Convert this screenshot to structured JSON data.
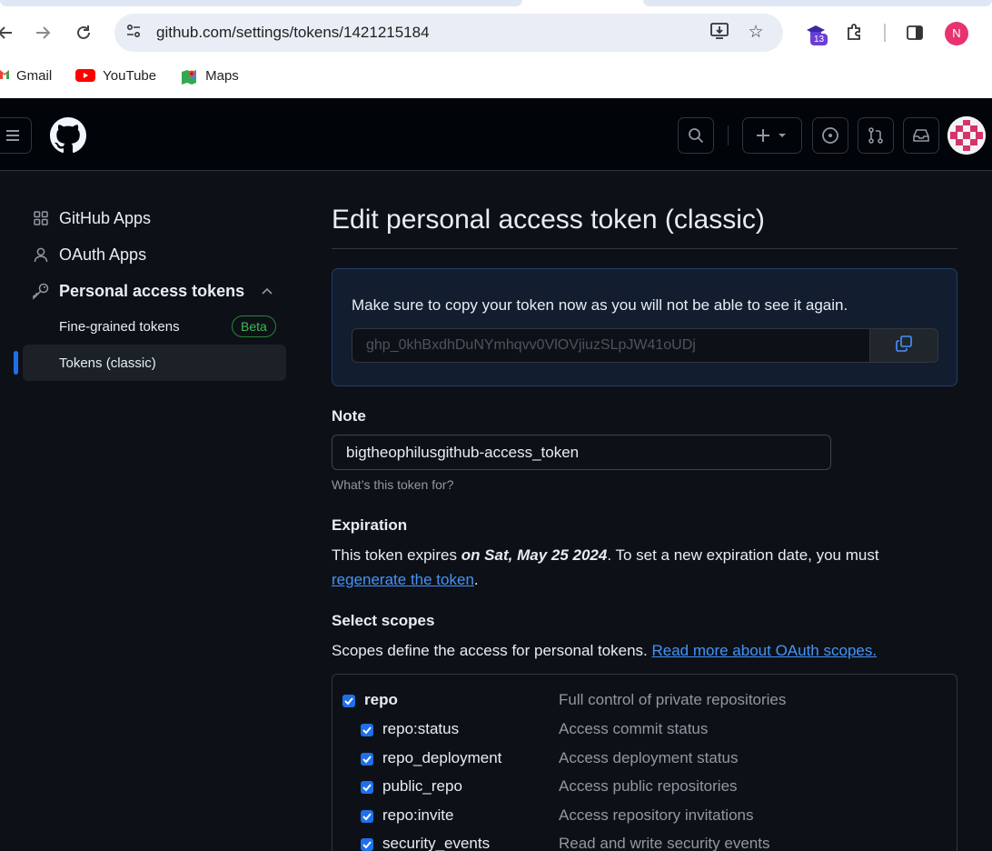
{
  "browser": {
    "url": "github.com/settings/tokens/1421215184",
    "extension_badge": "13",
    "profile_initial": "N",
    "bookmarks": [
      {
        "label": "Gmail",
        "icon": "gmail-icon"
      },
      {
        "label": "YouTube",
        "icon": "youtube-icon"
      },
      {
        "label": "Maps",
        "icon": "maps-icon"
      }
    ]
  },
  "sidebar": {
    "items": [
      {
        "label": "GitHub Apps",
        "icon": "apps-grid-icon"
      },
      {
        "label": "OAuth Apps",
        "icon": "person-icon"
      },
      {
        "label": "Personal access tokens",
        "icon": "key-icon"
      }
    ],
    "sub_items": [
      {
        "label": "Fine-grained tokens",
        "badge": "Beta"
      },
      {
        "label": "Tokens (classic)"
      }
    ]
  },
  "main": {
    "title": "Edit personal access token (classic)",
    "flash_message": "Make sure to copy your token now as you will not be able to see it again.",
    "token_value": "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",
    "note_label": "Note",
    "note_value": "bigtheophilusgithub-access_token",
    "note_hint": "What’s this token for?",
    "expiration_label": "Expiration",
    "expiration_prefix": "This token expires ",
    "expiration_date": "on Sat, May 25 2024",
    "expiration_suffix": ". To set a new expiration date, you must",
    "regenerate_link": "regenerate the token",
    "regenerate_after": ".",
    "scopes_label": "Select scopes",
    "scopes_intro": "Scopes define the access for personal tokens. ",
    "scopes_link": "Read more about OAuth scopes.",
    "scopes": [
      {
        "name": "repo",
        "desc": "Full control of private repositories",
        "checked": true,
        "child": false
      },
      {
        "name": "repo:status",
        "desc": "Access commit status",
        "checked": true,
        "child": true
      },
      {
        "name": "repo_deployment",
        "desc": "Access deployment status",
        "checked": true,
        "child": true
      },
      {
        "name": "public_repo",
        "desc": "Access public repositories",
        "checked": true,
        "child": true
      },
      {
        "name": "repo:invite",
        "desc": "Access repository invitations",
        "checked": true,
        "child": true
      },
      {
        "name": "security_events",
        "desc": "Read and write security events",
        "checked": true,
        "child": true
      }
    ]
  },
  "colors": {
    "accent": "#1f6feb",
    "link": "#4493f8",
    "background": "#0d1117"
  }
}
